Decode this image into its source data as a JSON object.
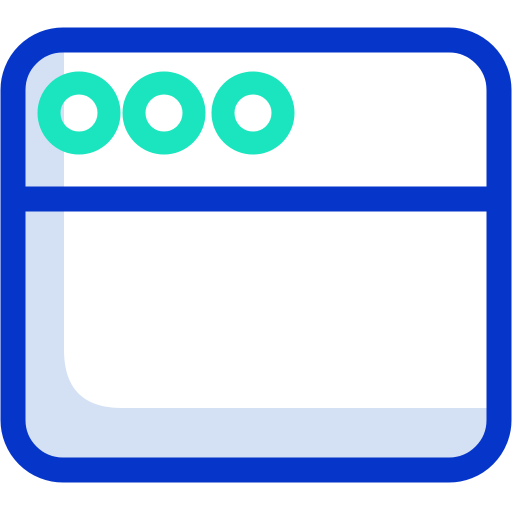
{
  "icon": {
    "name": "browser-window-icon",
    "colors": {
      "frame": "#0635c9",
      "shadow": "#d4e1f4",
      "dots": "#1ae5be",
      "background": "#ffffff"
    },
    "dot_count": 3
  }
}
